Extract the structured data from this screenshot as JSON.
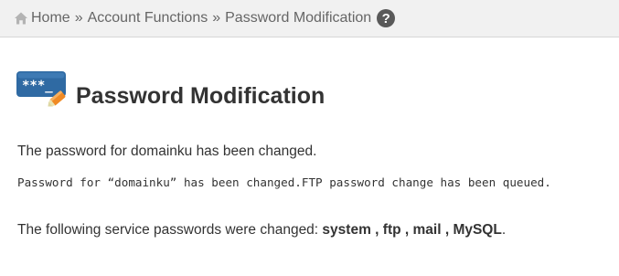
{
  "breadcrumb": {
    "home_label": "Home",
    "separator": "»",
    "account_label": "Account Functions",
    "current_label": "Password Modification",
    "help_glyph": "?"
  },
  "icons": {
    "home": "home-icon",
    "help": "question-circle-icon",
    "title": "password-key-icon"
  },
  "icon_glyphs": {
    "title_stars": "***_"
  },
  "page": {
    "title": "Password Modification",
    "message_main": "The password for domainku has been changed.",
    "message_detail": "Password for “domainku” has been changed.FTP password change has been queued.",
    "services_prefix": "The following service passwords were changed: ",
    "services": [
      "system",
      "ftp",
      "mail",
      "MySQL"
    ],
    "services_separator": " , ",
    "services_suffix": "."
  },
  "colors": {
    "breadcrumb_bg": "#f1f1f1",
    "icon_blue": "#2f6aa3",
    "icon_orange": "#f08a24",
    "text": "#333333"
  }
}
